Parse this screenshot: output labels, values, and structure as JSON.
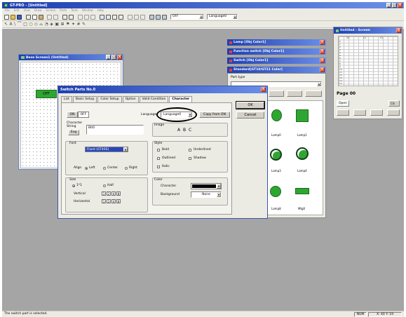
{
  "app": {
    "title": "GT-PRO - [Untitled]",
    "menu": [
      "File",
      "Edit",
      "View",
      "Draw",
      "Screen",
      "Parts",
      "Tools",
      "Window",
      "Help"
    ],
    "toolbar_fields": {
      "mode": "OFF",
      "language": "Language0"
    }
  },
  "base_screen": {
    "title": "Base Screen1 (Untitled)",
    "lamp_label": "OFF"
  },
  "side_panels": [
    {
      "label": "Lamp [Obj Color1]"
    },
    {
      "label": "Function switch [Obj Color1]"
    },
    {
      "label": "Switch [Obj Color1]"
    },
    {
      "label": "Standard[GT10/GT21 Color]"
    }
  ],
  "parts_library": {
    "type_label": "Part type",
    "lamps": [
      "Lamp0",
      "Lamp1",
      "Lamp3",
      "Lamp4",
      "Lamp8",
      "Mtg0"
    ]
  },
  "page_panel": {
    "title": "Untitled - Screen",
    "page": "Page 00",
    "buttons": [
      "Open",
      "Cls"
    ],
    "row_labels": [
      "0",
      "1",
      "2",
      "3",
      "4",
      "5",
      "6",
      "7",
      "8",
      "9",
      "10",
      "11",
      "12",
      "13",
      "14",
      "15"
    ],
    "col_labels": [
      "00",
      "01",
      "02"
    ]
  },
  "dialog": {
    "title": "Switch Parts No.0",
    "tabs": [
      "List",
      "Basic Setup",
      "Color Setup",
      "Option",
      "Valid Condition",
      "Character"
    ],
    "ok": "OK",
    "cancel": "Cancel",
    "on_label": "ON",
    "off_label": "OFF",
    "language_label": "Language",
    "language_value": "Language0",
    "copy_button": "Copy from ON",
    "character_label": "Character String",
    "string_value": "Bit0",
    "eng_button": "Eng",
    "image_label": "Image",
    "image_preview": "A B C",
    "font_label": "Font",
    "font_value": "Fixed (GT40S)",
    "align_label": "Align",
    "align_options": [
      "Left",
      "Center",
      "Right"
    ],
    "style_label": "Style",
    "styles": [
      "Bold",
      "Underlined",
      "Outlined",
      "Shadow",
      "Italic"
    ],
    "size_label": "Size",
    "size_options": [
      "1*1",
      "Half"
    ],
    "vertical_label": "Vertical",
    "horizontal_label": "Horizontal",
    "multipliers": [
      "1",
      "2",
      "4",
      "8"
    ],
    "color_label": "Color",
    "char_color_label": "Character",
    "background_label": "Background",
    "background_value": "None"
  },
  "status": {
    "message": "The switch part is selected.",
    "cells": [
      "NUM",
      "X: 40 Y: 19"
    ]
  }
}
